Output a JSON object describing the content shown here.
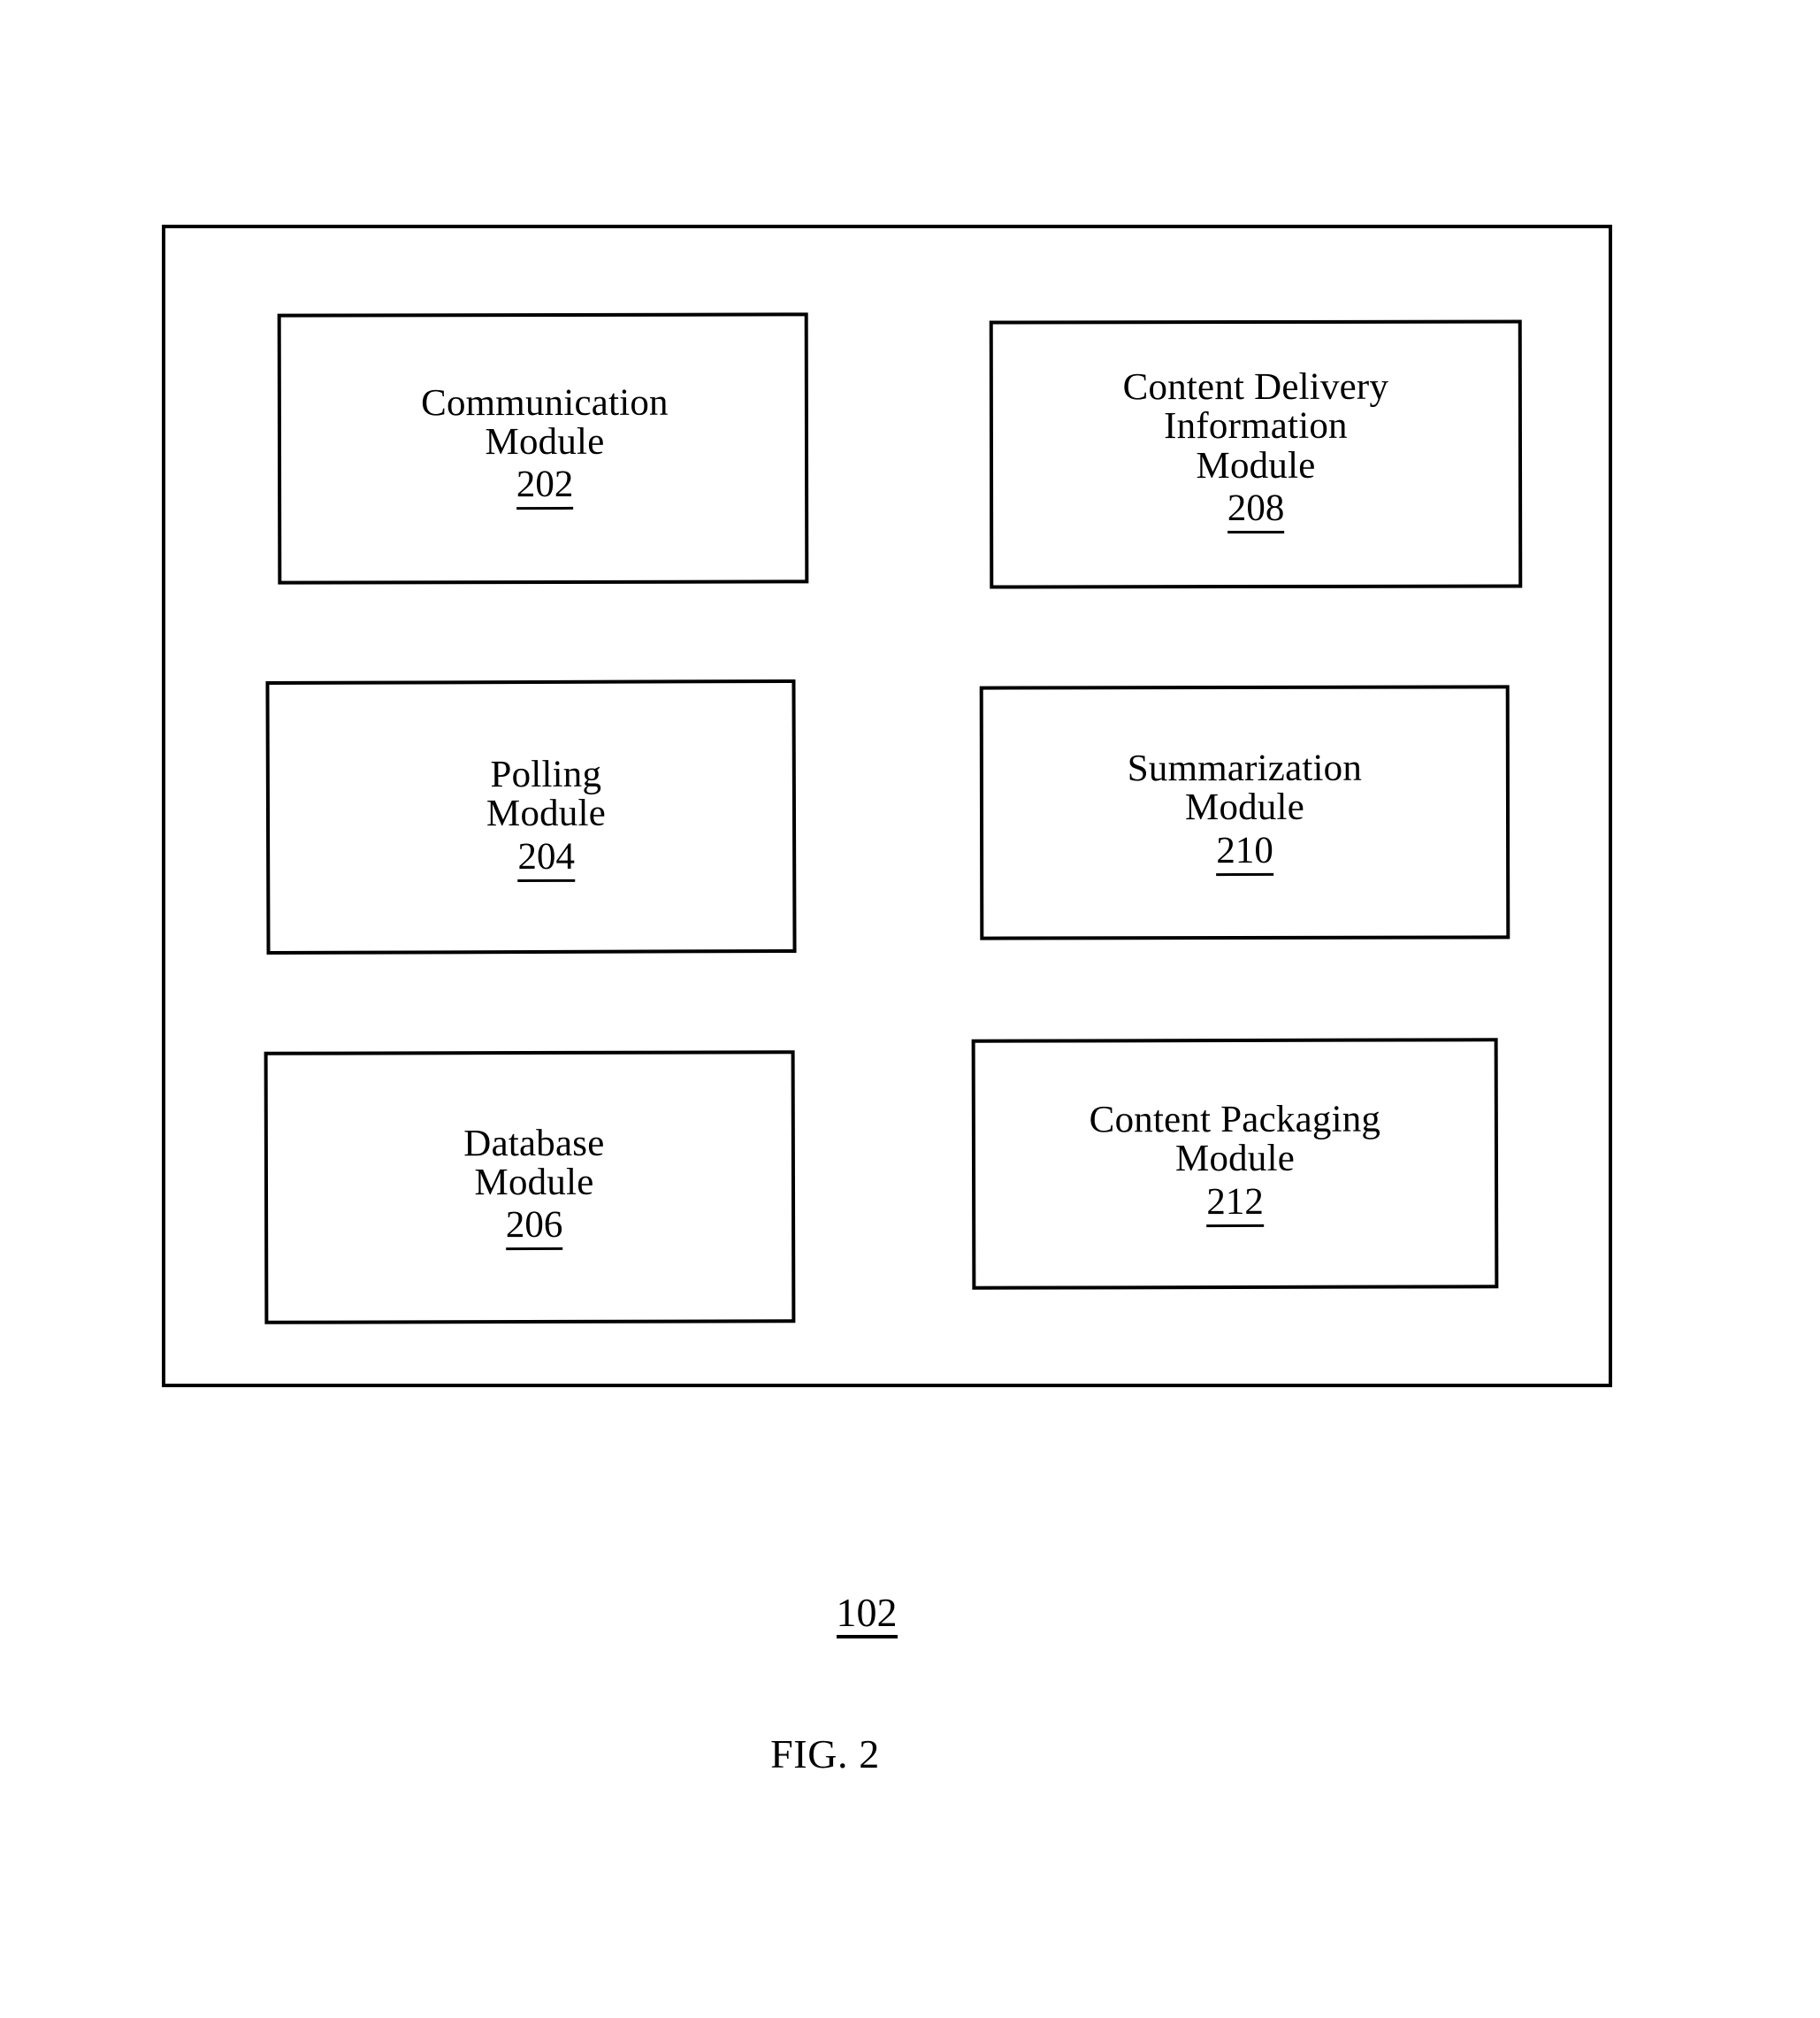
{
  "figure": {
    "caption": "FIG. 2",
    "system_reference": "102",
    "ink_color": "#000000",
    "background_color": "#ffffff"
  },
  "modules": [
    {
      "name": "communication-module",
      "title_lines": [
        "Communication",
        "Module"
      ],
      "line1": "Communication",
      "line2": "Module",
      "line3": "",
      "reference": "202",
      "column": "left",
      "row": 1
    },
    {
      "name": "polling-module",
      "title_lines": [
        "Polling",
        "Module"
      ],
      "line1": "Polling",
      "line2": "Module",
      "line3": "",
      "reference": "204",
      "column": "left",
      "row": 2
    },
    {
      "name": "database-module",
      "title_lines": [
        "Database",
        "Module"
      ],
      "line1": "Database",
      "line2": "Module",
      "line3": "",
      "reference": "206",
      "column": "left",
      "row": 3
    },
    {
      "name": "content-delivery-information-module",
      "title_lines": [
        "Content Delivery",
        "Information",
        "Module"
      ],
      "line1": "Content Delivery",
      "line2": "Information",
      "line3": "Module",
      "reference": "208",
      "column": "right",
      "row": 1
    },
    {
      "name": "summarization-module",
      "title_lines": [
        "Summarization",
        "Module"
      ],
      "line1": "Summarization",
      "line2": "Module",
      "line3": "",
      "reference": "210",
      "column": "right",
      "row": 2
    },
    {
      "name": "content-packaging-module",
      "title_lines": [
        "Content Packaging",
        "Module"
      ],
      "line1": "Content Packaging",
      "line2": "Module",
      "line3": "",
      "reference": "212",
      "column": "right",
      "row": 3
    }
  ]
}
